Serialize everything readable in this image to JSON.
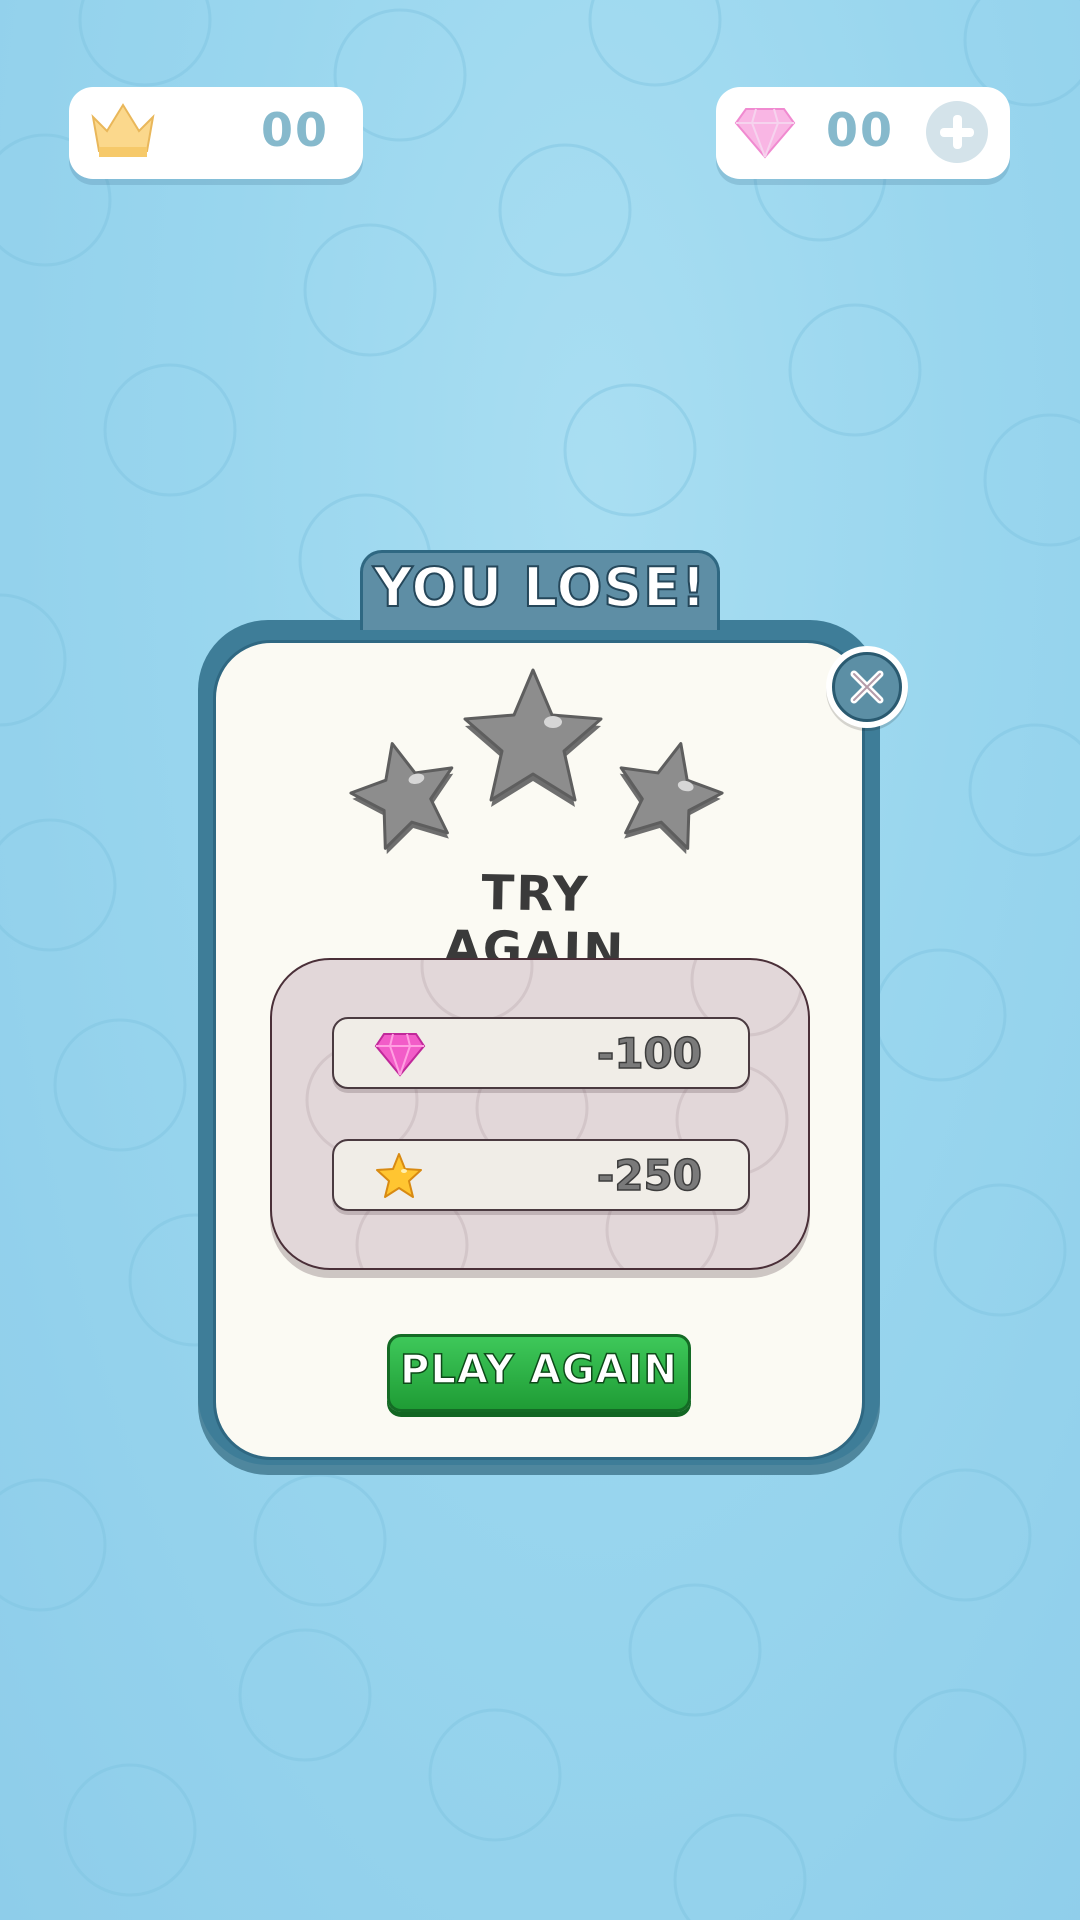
{
  "hud": {
    "crown_count": "00",
    "gem_count": "00"
  },
  "dialog": {
    "title": "YOU LOSE!",
    "subtitle": "TRY AGAIN",
    "stars_earned": 0,
    "stars_total": 3,
    "rewards": [
      {
        "icon": "gem-icon",
        "value": "-100"
      },
      {
        "icon": "star-icon",
        "value": "-250"
      }
    ],
    "play_again_label": "PLAY AGAIN"
  },
  "colors": {
    "background": "#9ad6ee",
    "frame": "#3e7d98",
    "button_green": "#2bb548",
    "star_empty": "#8c8c8c"
  }
}
